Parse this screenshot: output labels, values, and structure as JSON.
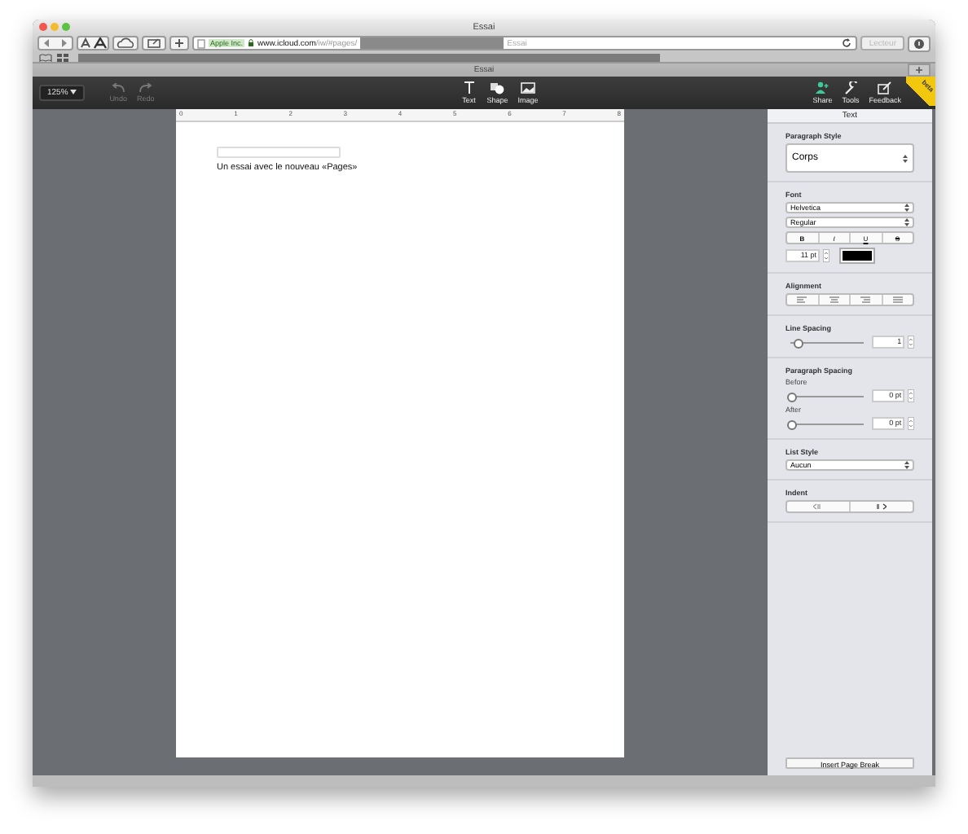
{
  "browser": {
    "title": "Essai",
    "address": {
      "site_badge": "Apple Inc.",
      "domain": "www.icloud.com",
      "path": "/iw/#pages/"
    },
    "search_value": "Essai",
    "reader_button": {
      "label": "Lecteur",
      "disabled": true
    },
    "tab_title": "Essai"
  },
  "toolbar": {
    "zoom": "125%",
    "history": [
      {
        "label": "Undo",
        "kind": "undo",
        "disabled": true
      },
      {
        "label": "Redo",
        "kind": "redo",
        "disabled": true
      }
    ],
    "insert": [
      {
        "label": "Text",
        "kind": "text"
      },
      {
        "label": "Shape",
        "kind": "shape"
      },
      {
        "label": "Image",
        "kind": "image"
      }
    ],
    "actions": [
      {
        "label": "Share",
        "kind": "share"
      },
      {
        "label": "Tools",
        "kind": "tools"
      },
      {
        "label": "Feedback",
        "kind": "feedback"
      }
    ],
    "ribbon": "beta"
  },
  "ruler": [
    "0",
    "1",
    "2",
    "3",
    "4",
    "5",
    "6",
    "7",
    "8"
  ],
  "document": {
    "text": "Un essai avec le nouveau «Pages»"
  },
  "sidebar": {
    "title": "Text",
    "paragraph_style_label": "Paragraph Style",
    "paragraph_style": "Corps",
    "font_label": "Font",
    "font_family": "Helvetica",
    "font_weight": "Regular",
    "format_buttons": [
      {
        "label": "B",
        "kind": "bold",
        "selected": false
      },
      {
        "label": "I",
        "kind": "italic",
        "selected": false
      },
      {
        "label": "U",
        "kind": "underline",
        "selected": false
      },
      {
        "label": "S",
        "kind": "strike",
        "selected": false
      }
    ],
    "font_size": "11 pt",
    "alignment_label": "Alignment",
    "alignment": [
      {
        "kind": "left",
        "selected": false
      },
      {
        "kind": "center",
        "selected": false
      },
      {
        "kind": "right",
        "selected": false
      },
      {
        "kind": "justify",
        "selected": false
      }
    ],
    "line_spacing_label": "Line Spacing",
    "line_spacing": {
      "level": 0.08,
      "value": "1"
    },
    "paragraph_spacing_label": "Paragraph Spacing",
    "spacing": [
      {
        "label": "Before",
        "level": 0,
        "value": "0 pt"
      },
      {
        "label": "After",
        "level": 0,
        "value": "0 pt"
      }
    ],
    "list_style_label": "List Style",
    "list_style": "Aucun",
    "indent_label": "Indent",
    "page_break_button": "Insert Page Break"
  }
}
